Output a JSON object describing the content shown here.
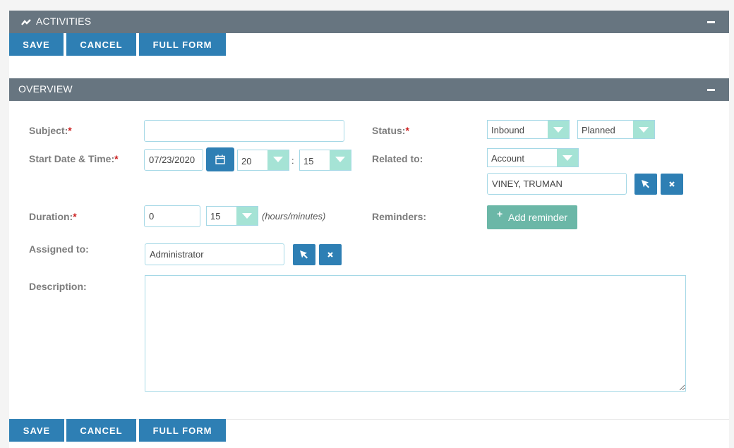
{
  "activities": {
    "title": "ACTIVITIES"
  },
  "top_buttons": {
    "save": "SAVE",
    "cancel": "CANCEL",
    "full_form": "FULL FORM"
  },
  "overview": {
    "title": "OVERVIEW"
  },
  "form": {
    "subject": {
      "label": "Subject:",
      "required": "*",
      "value": ""
    },
    "start": {
      "label": "Start Date & Time:",
      "required": "*",
      "date": "07/23/2020",
      "hour": "20",
      "colon": ":",
      "minute": "15"
    },
    "duration": {
      "label": "Duration:",
      "required": "*",
      "hours": "0",
      "minutes": "15",
      "hint": "(hours/minutes)"
    },
    "assigned": {
      "label": "Assigned to:",
      "value": "Administrator"
    },
    "description": {
      "label": "Description:",
      "value": ""
    },
    "status": {
      "label": "Status:",
      "required": "*",
      "direction": "Inbound",
      "state": "Planned"
    },
    "related": {
      "label": "Related to:",
      "type": "Account",
      "name": "VINEY, TRUMAN"
    },
    "reminders": {
      "label": "Reminders:",
      "add_plus": "+",
      "add_label": "Add reminder"
    }
  },
  "bottom_buttons": {
    "save": "SAVE",
    "cancel": "CANCEL",
    "full_form": "FULL FORM"
  },
  "colors": {
    "header": "#677580",
    "primary": "#2e7fb4",
    "select_arrow": "#a5e3d5",
    "reminder": "#6bb7a7",
    "required": "#cc1f1f"
  },
  "icons": {
    "activities": "activity-chart-icon",
    "collapse": "minus-icon",
    "calendar": "calendar-icon",
    "select": "cursor-arrow-icon",
    "clear": "close-icon"
  }
}
